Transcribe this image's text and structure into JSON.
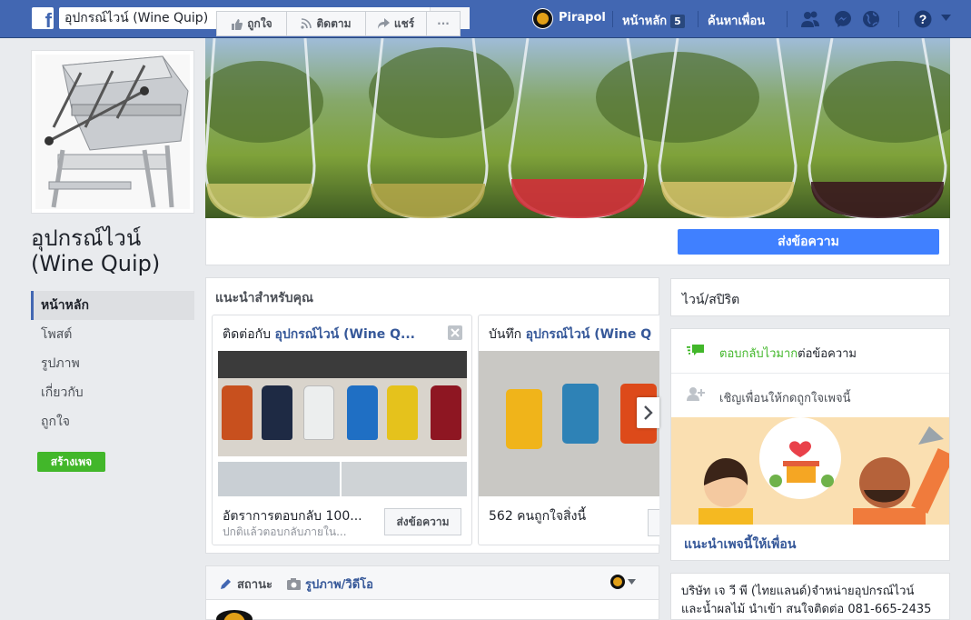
{
  "header": {
    "search_value": "อุปกรณ์ไวน์ (Wine Quip)",
    "user_name": "Pirapol",
    "home_label": "หน้าหลัก",
    "home_count": "5",
    "find_friends_label": "ค้นหาเพื่อน"
  },
  "page": {
    "name": "อุปกรณ์ไวน์ (Wine Quip)"
  },
  "leftnav": {
    "items": [
      {
        "label": "หน้าหลัก"
      },
      {
        "label": "โพสต์"
      },
      {
        "label": "รูปภาพ"
      },
      {
        "label": "เกี่ยวกับ"
      },
      {
        "label": "ถูกใจ"
      }
    ],
    "create_page": "สร้างเพจ"
  },
  "actions": {
    "like": "ถูกใจ",
    "follow": "ติดตาม",
    "share": "แชร์",
    "more": "···",
    "send_message": "ส่งข้อความ"
  },
  "recommendations": {
    "title": "แนะนำสำหรับคุณ",
    "card1": {
      "prefix": "ติดต่อกับ",
      "page": "อุปกรณ์ไวน์ (Wine Q...",
      "stat": "อัตราการตอบกลับ 100...",
      "sub": "ปกติแล้วตอบกลับภายใน...",
      "button": "ส่งข้อความ"
    },
    "card2": {
      "prefix": "บันทึก",
      "page": "อุปกรณ์ไวน์ (Wine Q",
      "stat": "562 คนถูกใจสิ่งนี้"
    }
  },
  "sidebar": {
    "category": "ไวน์/สปิริต",
    "response": "ตอบกลับไวมาก",
    "response_suffix": "ต่อข้อความ",
    "invite": "เชิญเพื่อนให้กดถูกใจเพจนี้",
    "suggest": "แนะนำเพจนี้ให้เพื่อน",
    "about_line1": "บริษัท เจ วี พี (ไทยแลนด์)จำหน่ายอุปกรณ์ไวน์",
    "about_line2": "และน้ำผลไม้ นำเข้า สนใจติดต่อ 081-665-2435"
  },
  "composer": {
    "status": "สถานะ",
    "photo_video": "รูปภาพ/วิดีโอ"
  },
  "colors": {
    "brand_blue": "#4267b2",
    "send_blue": "#4080ff",
    "green": "#42b72a",
    "link": "#365899"
  }
}
